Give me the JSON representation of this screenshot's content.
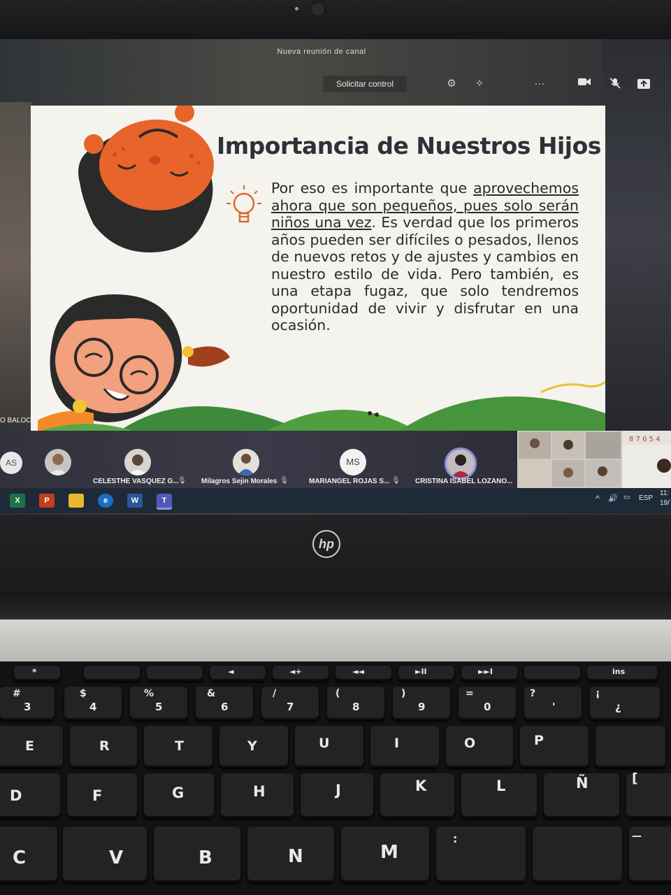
{
  "meeting": {
    "title": "Nueva reunión de canal",
    "request_control": "Solicitar control"
  },
  "toolbar_icons": [
    "settings-icon",
    "more-icon",
    "camera-icon",
    "mic-muted-icon",
    "share-screen-icon"
  ],
  "slide": {
    "title": "Importancia de Nuestros Hijos",
    "p1": "Por eso es importante que",
    "p1_underlined": "aprovechemos ahora que son pequeños, pues solo serán niños una vez",
    "p1_end": ".",
    "p2": "Es verdad que los primeros años pueden ser difíciles o pesados, llenos de nuevos retos y de ajustes y cambios en nuestro estilo de vida. Pero también, es una etapa fugaz, que solo tendremos oportunidad de vivir y disfrutar en una ocasión."
  },
  "left_camera_label": "O BALOCO",
  "participants": [
    {
      "initials": "AS",
      "name": ""
    },
    {
      "initials": "",
      "name": ""
    },
    {
      "initials": "",
      "name": "CELESTHE VASQUEZ G..."
    },
    {
      "initials": "",
      "name": "Milagros Sejin Morales"
    },
    {
      "initials": "MS",
      "name": "MARIANGEL ROJAS S..."
    },
    {
      "initials": "",
      "name": "CRISTINA ISABEL LOZANO..."
    }
  ],
  "taskbar": {
    "apps": [
      "X",
      "P",
      "",
      "e",
      "W",
      "T"
    ],
    "lang": "ESP",
    "time": "11:",
    "date": "19/"
  },
  "colors": {
    "taskbar": "#1f2a38",
    "participant_bar": "#36364a",
    "slide_bg": "#f4f3ee"
  },
  "keyboard": {
    "fn_row": [
      "*",
      "",
      "",
      "◄",
      "◄+",
      "◄◄",
      "►II",
      "►►I",
      "",
      "ins"
    ],
    "number_row": [
      {
        "top": "#",
        "main": "3"
      },
      {
        "top": "$",
        "main": "4"
      },
      {
        "top": "%",
        "main": "5"
      },
      {
        "top": "&",
        "main": "6"
      },
      {
        "top": "/",
        "main": "7"
      },
      {
        "top": "(",
        "main": "8"
      },
      {
        "top": ")",
        "main": "9"
      },
      {
        "top": "=",
        "main": "0"
      },
      {
        "top": "?",
        "main": "'"
      },
      {
        "top": "¡",
        "main": "¿"
      }
    ],
    "row2": [
      "E",
      "R",
      "T",
      "Y",
      "U",
      "I",
      "O",
      "P",
      ""
    ],
    "row3": [
      "D",
      "F",
      "G",
      "H",
      "J",
      "K",
      "L",
      "Ñ",
      "["
    ],
    "row4": [
      "C",
      "V",
      "B",
      "N",
      "M",
      "",
      ""
    ]
  }
}
